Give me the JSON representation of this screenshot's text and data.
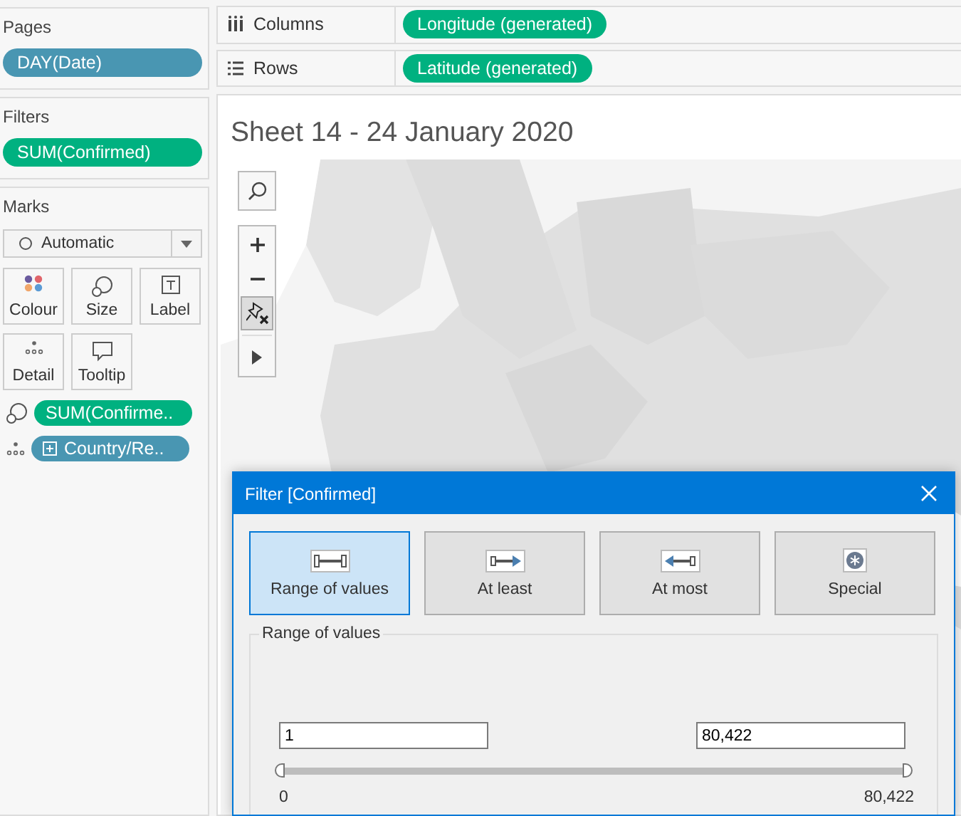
{
  "pages": {
    "title": "Pages",
    "pills": [
      {
        "label": "DAY(Date)",
        "color": "#4996b2"
      }
    ]
  },
  "filters": {
    "title": "Filters",
    "pills": [
      {
        "label": "SUM(Confirmed)",
        "color": "#00b180"
      }
    ]
  },
  "marks": {
    "title": "Marks",
    "mark_type": "Automatic",
    "cards": [
      {
        "label": "Colour",
        "kind": "colour"
      },
      {
        "label": "Size",
        "kind": "size"
      },
      {
        "label": "Label",
        "kind": "label"
      },
      {
        "label": "Detail",
        "kind": "detail"
      },
      {
        "label": "Tooltip",
        "kind": "tooltip"
      }
    ],
    "fields": [
      {
        "label": "SUM(Confirme..",
        "kind": "size",
        "color": "#00b180",
        "expandable": false
      },
      {
        "label": "Country/Re..",
        "kind": "detail",
        "color": "#4996b2",
        "expandable": true
      }
    ]
  },
  "shelves": [
    {
      "label": "Columns",
      "kind": "columns",
      "pill": "Longitude (generated)",
      "color": "#00b180"
    },
    {
      "label": "Rows",
      "kind": "rows",
      "pill": "Latitude (generated)",
      "color": "#00b180"
    }
  ],
  "sheet": {
    "title": "Sheet 14 - 24 January 2020",
    "map_tools": [
      {
        "kind": "search",
        "active": false
      },
      {
        "kind": "zoom-in",
        "active": false
      },
      {
        "kind": "zoom-out",
        "active": false
      },
      {
        "kind": "pin",
        "active": true
      },
      {
        "kind": "expand",
        "active": false
      }
    ]
  },
  "dialog": {
    "title": "Filter [Confirmed]",
    "tabs": [
      {
        "label": "Range of values",
        "kind": "range",
        "selected": true
      },
      {
        "label": "At least",
        "kind": "least",
        "selected": false
      },
      {
        "label": "At most",
        "kind": "most",
        "selected": false
      },
      {
        "label": "Special",
        "kind": "special",
        "selected": false
      }
    ],
    "group": "Range of values",
    "min_value": "1",
    "max_value": "80,422",
    "slider": {
      "thumbs": [
        {
          "level": 0
        },
        {
          "level": 1
        }
      ]
    },
    "scale_min": "0",
    "scale_max": "80,422"
  }
}
